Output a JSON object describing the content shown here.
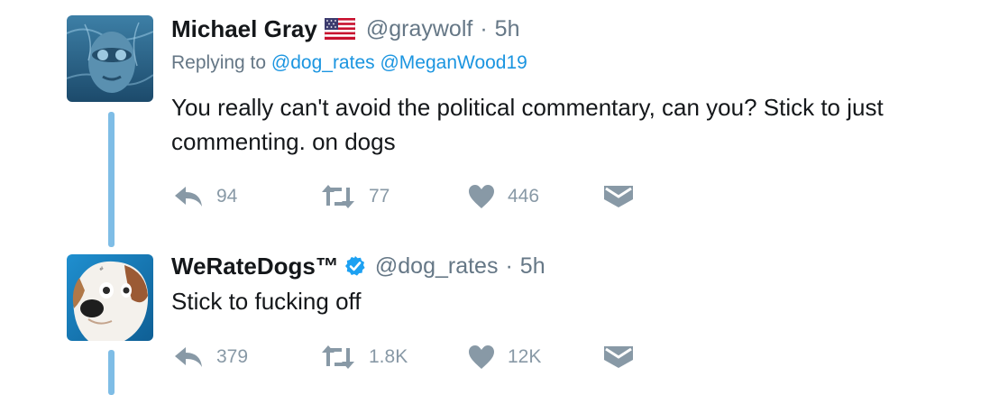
{
  "tweets": [
    {
      "author_name": "Michael Gray",
      "flag_icon": "us-flag-emoji",
      "handle": "@graywolf",
      "separator": "·",
      "time": "5h",
      "replying_prefix": "Replying to",
      "replying_to": [
        "@dog_rates",
        "@MeganWood19"
      ],
      "text": "You really can't avoid the political commentary, can you? Stick to just commenting. on dogs",
      "counts": {
        "reply": "94",
        "retweet": "77",
        "like": "446"
      }
    },
    {
      "author_name": "WeRateDogs™",
      "verified_icon": "verified-badge-icon",
      "handle": "@dog_rates",
      "separator": "·",
      "time": "5h",
      "text": "Stick to fucking off",
      "counts": {
        "reply": "379",
        "retweet": "1.8K",
        "like": "12K"
      }
    }
  ],
  "colors": {
    "link": "#1b95e0",
    "secondary_text": "#657786",
    "action_icon": "#8899a6",
    "thread_line": "#7fbde6",
    "verified": "#1da1f2"
  }
}
